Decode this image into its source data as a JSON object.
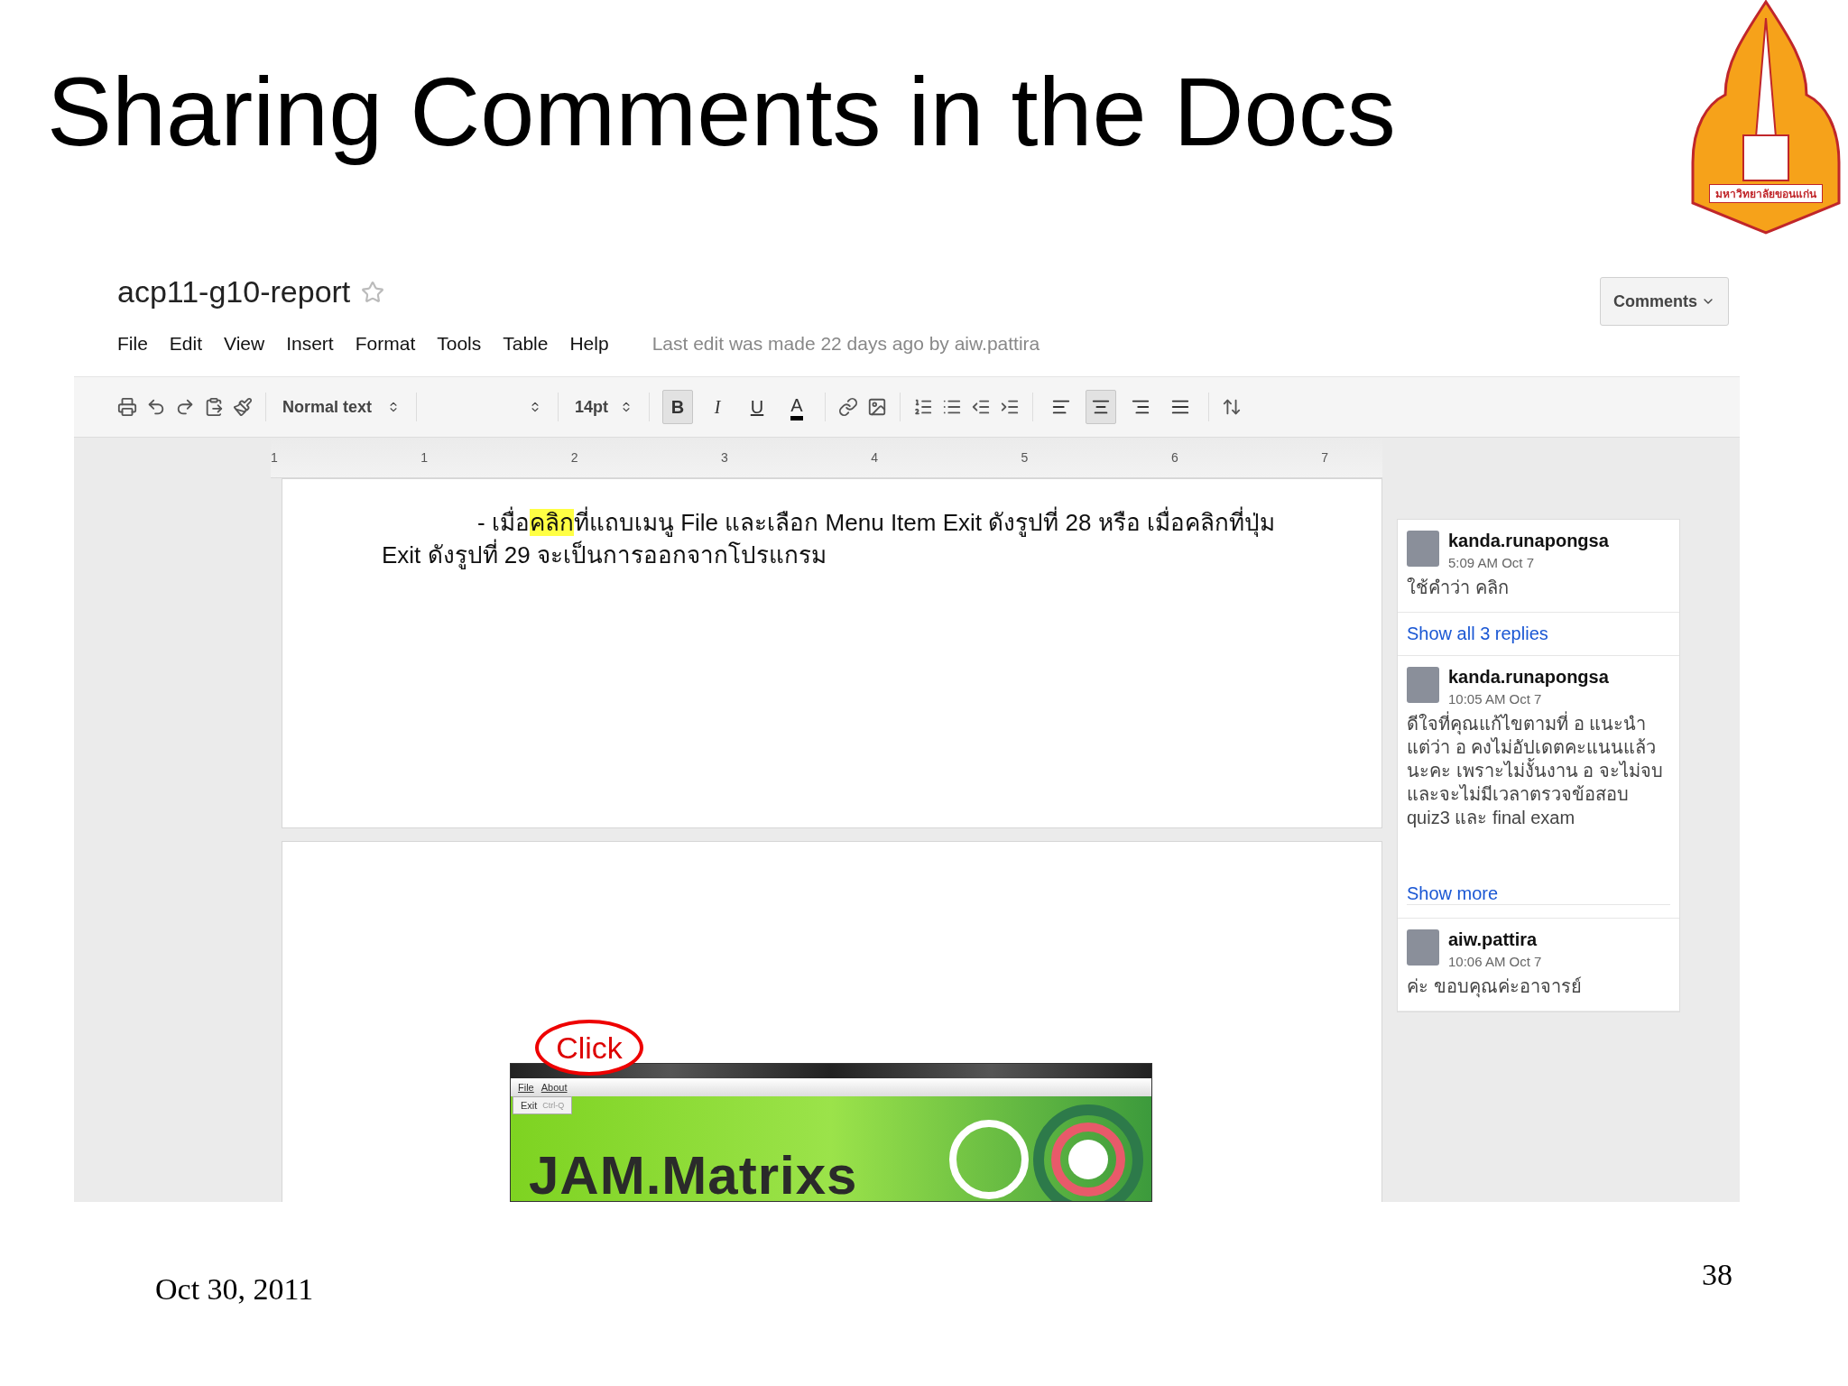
{
  "slide_title": "Sharing Comments in the Docs",
  "logo": {
    "caption": "มหาวิทยาลัยขอนแก่น"
  },
  "doc": {
    "title": "acp11-g10-report",
    "starred": false,
    "menu": [
      "File",
      "Edit",
      "View",
      "Insert",
      "Format",
      "Tools",
      "Table",
      "Help"
    ],
    "last_edit": "Last edit was made 22 days ago by aiw.pattira",
    "comments_button": "Comments",
    "toolbar": {
      "style": "Normal text",
      "font_size": "14pt",
      "format": [
        {
          "label": "B",
          "kind": "bold",
          "selected": true
        },
        {
          "label": "I",
          "kind": "italic",
          "selected": false
        },
        {
          "label": "U",
          "kind": "underline",
          "selected": false
        },
        {
          "label": "A",
          "kind": "color",
          "selected": false
        }
      ],
      "align": [
        {
          "kind": "left",
          "selected": false
        },
        {
          "kind": "center",
          "selected": true
        },
        {
          "kind": "right",
          "selected": false
        },
        {
          "kind": "justify",
          "selected": false
        }
      ]
    },
    "ruler": [
      "1",
      "1",
      "2",
      "3",
      "4",
      "5",
      "6",
      "7"
    ],
    "paragraph": {
      "before": "- เมื่อ",
      "highlight": "คลิก",
      "after": "ที่แถบเมนู File และเลือก Menu Item Exit ดังรูปที่ 28 หรือ เมื่อคลิกที่ปุ่ม Exit ดังรูปที่ 29 จะเป็นการออกจากโปรแกรม"
    },
    "embedded_app": {
      "callout": "Click",
      "menu": [
        "File",
        "About"
      ],
      "menu_item": "Exit",
      "shortcut": "Ctrl-Q",
      "banner": "JAM.Matrixs"
    }
  },
  "comments": [
    {
      "author": "kanda.runapongsa",
      "time": "5:09 AM Oct 7",
      "text": "ใช้คำว่า คลิก",
      "link": "Show all 3 replies"
    },
    {
      "author": "kanda.runapongsa",
      "time": "10:05 AM Oct 7",
      "text": "ดีใจที่คุณแก้ไขตามที่ อ แนะนำ แต่ว่า อ คงไม่อัปเดตคะแนนแล้วนะคะ เพราะไม่งั้นงาน อ จะไม่จบ และจะไม่มีเวลาตรวจข้อสอบ quiz3 และ final exam",
      "link": "Show more"
    },
    {
      "author": "aiw.pattira",
      "time": "10:06 AM Oct 7",
      "text": "ค่ะ ขอบคุณค่ะอาจารย์"
    }
  ],
  "footer": {
    "date": "Oct 30, 2011",
    "page_number": "38"
  }
}
